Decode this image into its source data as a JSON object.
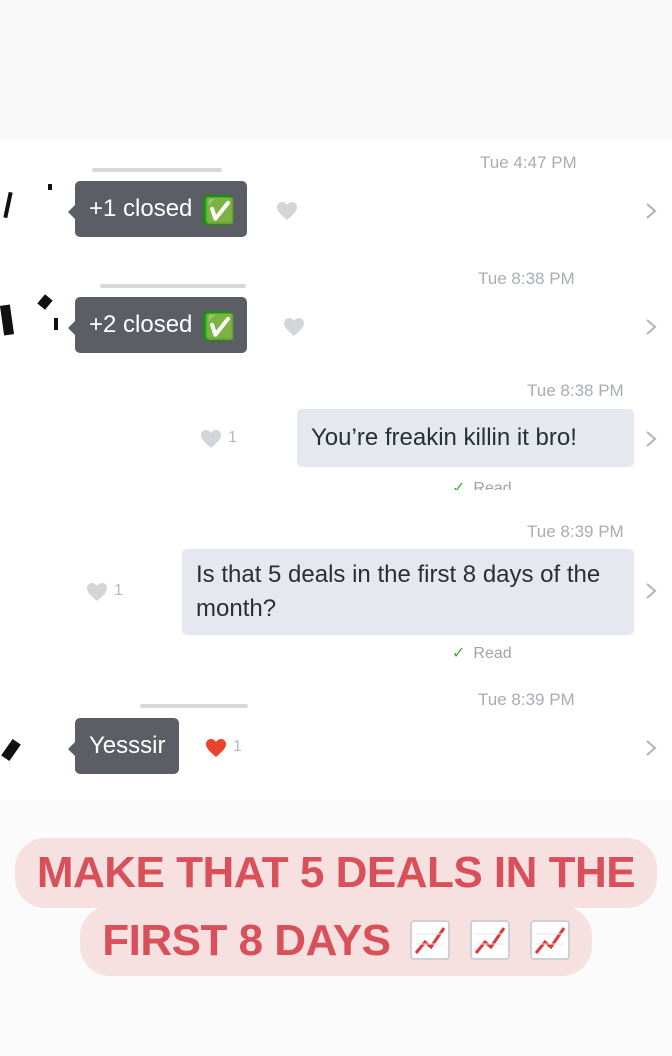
{
  "messages": [
    {
      "time": "Tue 4:47 PM",
      "direction": "incoming",
      "text": "+1 closed",
      "emoji": "✅",
      "like_count": ""
    },
    {
      "time": "Tue 8:38 PM",
      "direction": "incoming",
      "text": "+2 closed",
      "emoji": "✅",
      "like_count": ""
    },
    {
      "time": "Tue 8:38 PM",
      "direction": "outgoing",
      "text": "You’re freakin killin it bro!",
      "like_count": "1",
      "read_label": "Read"
    },
    {
      "time": "Tue 8:39 PM",
      "direction": "outgoing",
      "text": "Is that 5 deals in the first 8 days of the month?",
      "like_count": "1",
      "read_label": "Read"
    },
    {
      "time": "Tue 8:39 PM",
      "direction": "incoming",
      "text": "Yesssir",
      "like_count": "1",
      "liked": true
    }
  ],
  "banner": {
    "line1": "MAKE THAT 5 DEALS IN THE",
    "line2": "FIRST 8 DAYS",
    "emoji_icon": "chart-increasing-icon",
    "emoji_count": 3
  },
  "colors": {
    "incoming_bubble": "#5b5f65",
    "outgoing_bubble": "#e5e8ef",
    "liked_heart": "#e8452c",
    "unliked_heart": "#d3d5d8",
    "banner_text": "#d8505a",
    "banner_bg": "#f7e0e0",
    "read_check": "#3cb03c"
  }
}
